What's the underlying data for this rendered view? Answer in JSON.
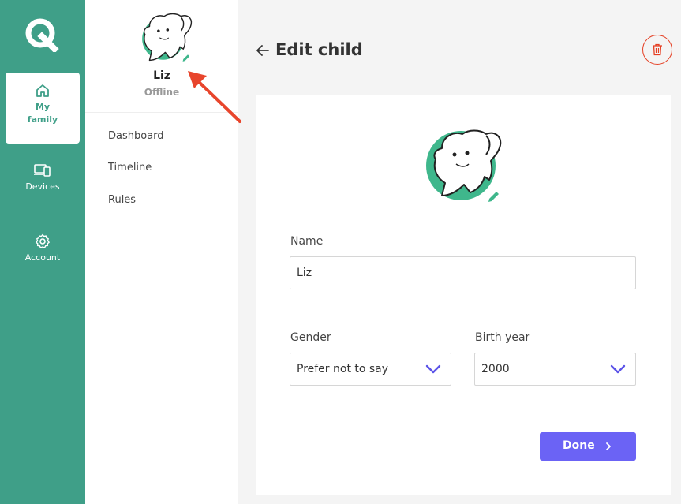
{
  "sidebar": {
    "nav": [
      {
        "label_1": "My",
        "label_2": "family",
        "icon": "home-icon"
      },
      {
        "label": "Devices",
        "icon": "devices-icon"
      },
      {
        "label": "Account",
        "icon": "gear-icon"
      }
    ]
  },
  "child_panel": {
    "name": "Liz",
    "status": "Offline",
    "menu": [
      "Dashboard",
      "Timeline",
      "Rules"
    ]
  },
  "header": {
    "title": "Edit child"
  },
  "form": {
    "name_label": "Name",
    "name_value": "Liz",
    "gender_label": "Gender",
    "gender_value": "Prefer not to say",
    "birth_year_label": "Birth year",
    "birth_year_value": "2000",
    "done_label": "Done"
  },
  "colors": {
    "brand": "#3f9f88",
    "primary_button": "#6b63f5",
    "delete": "#e53e22",
    "annotation_arrow": "#e8452c"
  }
}
